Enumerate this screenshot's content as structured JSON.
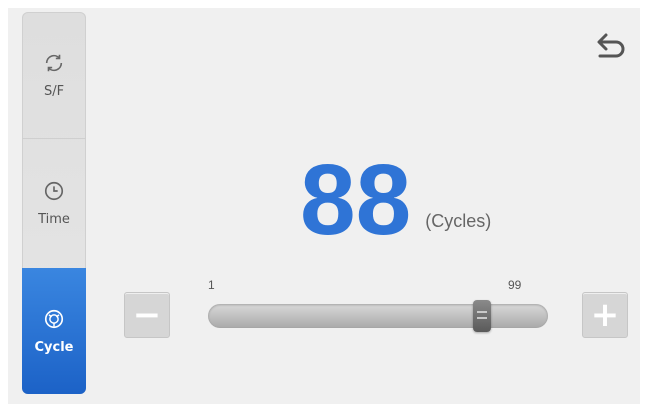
{
  "sidebar": {
    "tabs": [
      {
        "label": "S/F",
        "icon": "refresh-icon",
        "active": false
      },
      {
        "label": "Time",
        "icon": "clock-icon",
        "active": false
      },
      {
        "label": "Cycle",
        "icon": "cycle-icon",
        "active": true
      }
    ]
  },
  "header": {
    "back_icon": "back-arrow-icon"
  },
  "main": {
    "value": "88",
    "unit": "(Cycles)"
  },
  "slider": {
    "min_label": "1",
    "max_label": "99",
    "min": 1,
    "max": 99,
    "value": 88,
    "decrement_label": "−",
    "increment_label": "+"
  },
  "colors": {
    "accent": "#2f74d6",
    "active_tab": "#1c62c7"
  }
}
